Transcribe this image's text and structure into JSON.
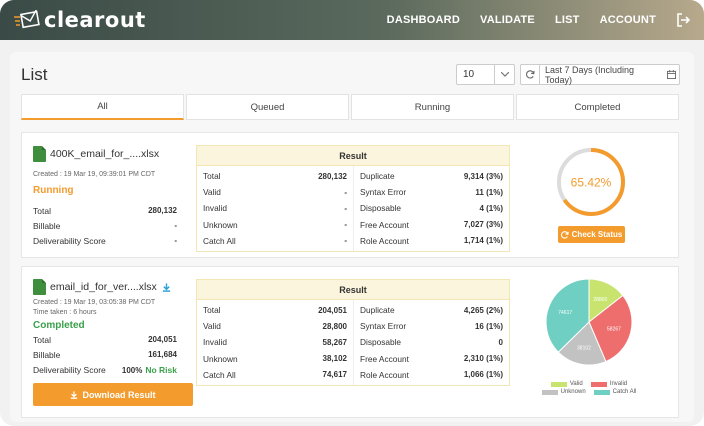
{
  "brand": {
    "name": "clearout"
  },
  "nav": [
    "DASHBOARD",
    "VALIDATE",
    "LIST",
    "ACCOUNT"
  ],
  "page": {
    "title": "List",
    "page_size": "10",
    "date_range": "Last 7 Days (Including Today)"
  },
  "tabs": [
    "All",
    "Queued",
    "Running",
    "Completed"
  ],
  "lists": [
    {
      "filename": "400K_email_for_....xlsx",
      "created": "Created : 19 Mar 19, 09:39:01 PM CDT",
      "status": "Running",
      "summary": [
        {
          "label": "Total",
          "value": "280,132"
        },
        {
          "label": "Billable",
          "value": "-"
        },
        {
          "label": "Deliverability Score",
          "value": "-"
        }
      ],
      "result_title": "Result",
      "result_left": [
        {
          "label": "Total",
          "value": "280,132"
        },
        {
          "label": "Valid",
          "value": "-"
        },
        {
          "label": "Invalid",
          "value": "-"
        },
        {
          "label": "Unknown",
          "value": "-"
        },
        {
          "label": "Catch All",
          "value": "-"
        }
      ],
      "result_right": [
        {
          "label": "Duplicate",
          "value": "9,314 (3%)"
        },
        {
          "label": "Syntax Error",
          "value": "11 (1%)"
        },
        {
          "label": "Disposable",
          "value": "4 (1%)"
        },
        {
          "label": "Free Account",
          "value": "7,027 (3%)"
        },
        {
          "label": "Role Account",
          "value": "1,714 (1%)"
        }
      ],
      "progress": 65.42,
      "progress_label": "65.42%",
      "action": "Check Status"
    },
    {
      "filename": "email_id_for_ver....xlsx",
      "created": "Created : 19 Mar 19, 03:05:38 PM CDT",
      "time_taken": "Time taken : 6 hours",
      "status": "Completed",
      "summary": [
        {
          "label": "Total",
          "value": "204,051"
        },
        {
          "label": "Billable",
          "value": "161,684"
        },
        {
          "label": "Deliverability Score",
          "value": "100%",
          "badge": "No Risk"
        }
      ],
      "result_title": "Result",
      "result_left": [
        {
          "label": "Total",
          "value": "204,051"
        },
        {
          "label": "Valid",
          "value": "28,800"
        },
        {
          "label": "Invalid",
          "value": "58,267"
        },
        {
          "label": "Unknown",
          "value": "38,102"
        },
        {
          "label": "Catch All",
          "value": "74,617"
        }
      ],
      "result_right": [
        {
          "label": "Duplicate",
          "value": "4,265 (2%)"
        },
        {
          "label": "Syntax Error",
          "value": "16 (1%)"
        },
        {
          "label": "Disposable",
          "value": "0"
        },
        {
          "label": "Free Account",
          "value": "2,310 (1%)"
        },
        {
          "label": "Role Account",
          "value": "1,066 (1%)"
        }
      ],
      "action": "Download Result",
      "pie": [
        {
          "name": "Valid",
          "value": 28800,
          "label": "28800",
          "color": "#c8e46e"
        },
        {
          "name": "Invalid",
          "value": 58267,
          "label": "58267",
          "color": "#ee6e6e"
        },
        {
          "name": "Unknown",
          "value": 38102,
          "label": "38102",
          "color": "#c2c2c2"
        },
        {
          "name": "Catch All",
          "value": 74617,
          "label": "74617",
          "color": "#6fcfc2"
        }
      ]
    }
  ],
  "colors": {
    "accent": "#f49b2d",
    "success": "#3aa04a"
  }
}
